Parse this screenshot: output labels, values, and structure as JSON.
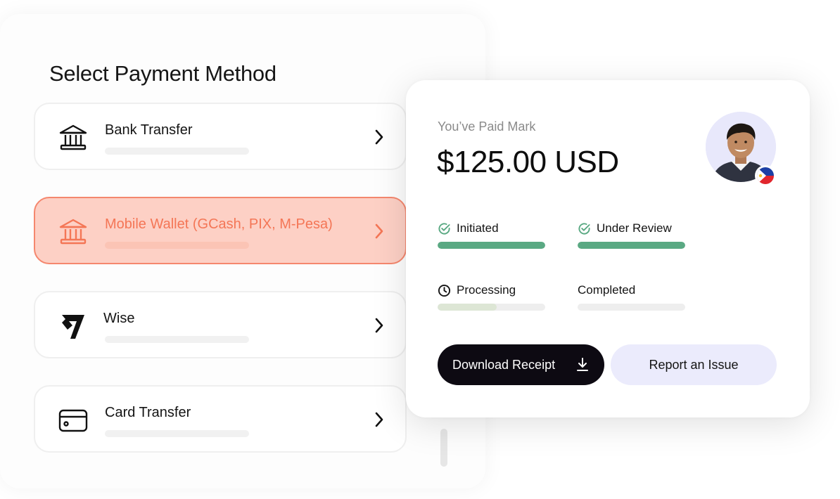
{
  "panel": {
    "title": "Select Payment Method",
    "methods": [
      {
        "label": "Bank Transfer",
        "icon": "bank-icon",
        "selected": false
      },
      {
        "label": "Mobile Wallet (GCash, PIX, M-Pesa)",
        "icon": "bank-icon",
        "selected": true
      },
      {
        "label": "Wise",
        "icon": "wise-logo-icon",
        "selected": false
      },
      {
        "label": "Card Transfer",
        "icon": "card-icon",
        "selected": false
      }
    ]
  },
  "payment": {
    "paid_label": "You’ve Paid Mark",
    "amount": "$125.00 USD",
    "avatar_icon": "avatar",
    "flag_icon": "philippines-flag-icon",
    "steps": [
      {
        "label": "Initiated",
        "status": "done",
        "progress": 1.0
      },
      {
        "label": "Under Review",
        "status": "done",
        "progress": 1.0
      },
      {
        "label": "Processing",
        "status": "in-progress",
        "progress": 0.55
      },
      {
        "label": "Completed",
        "status": "pending",
        "progress": 0.0
      }
    ],
    "download_label": "Download Receipt",
    "report_label": "Report an Issue"
  },
  "colors": {
    "accent": "#f47656",
    "accent_bg": "#fdd0c5",
    "success": "#5aa983",
    "progress_partial": "#dde6d5",
    "dark_button": "#0d0a12",
    "secondary_button": "#ebebfc"
  }
}
